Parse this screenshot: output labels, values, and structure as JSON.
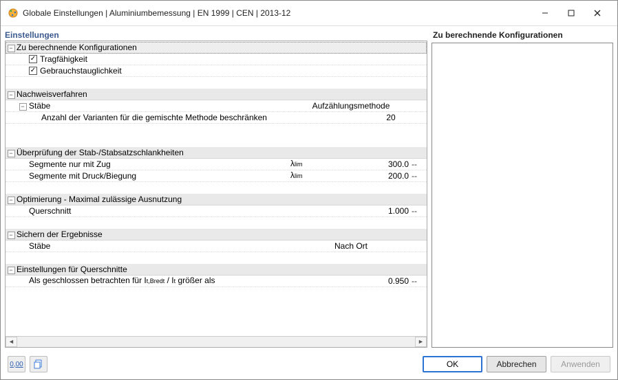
{
  "window": {
    "title": "Globale Einstellungen | Aluminiumbemessung | EN 1999 | CEN | 2013-12"
  },
  "left": {
    "title": "Einstellungen",
    "sections": {
      "configs": {
        "header": "Zu berechnende Konfigurationen",
        "items": {
          "carry": "Tragfähigkeit",
          "service": "Gebrauchstauglichkeit"
        }
      },
      "method": {
        "header": "Nachweisverfahren",
        "bars": {
          "label": "Stäbe",
          "value": "Aufzählungsmethode",
          "limit_label": "Anzahl der Varianten für die gemischte Methode beschränken",
          "limit_value": "20"
        }
      },
      "slender": {
        "header": "Überprüfung der Stab-/Stabsatzschlankheiten",
        "tension": {
          "label": "Segmente nur mit Zug",
          "sym": "λlim",
          "value": "300.0",
          "unit": "--"
        },
        "bending": {
          "label": "Segmente mit Druck/Biegung",
          "sym": "λlim",
          "value": "200.0",
          "unit": "--"
        }
      },
      "opt": {
        "header": "Optimierung - Maximal zulässige Ausnutzung",
        "cs": {
          "label": "Querschnitt",
          "value": "1.000",
          "unit": "--"
        }
      },
      "save": {
        "header": "Sichern der Ergebnisse",
        "bars": {
          "label": "Stäbe",
          "value": "Nach Ort"
        }
      },
      "cs": {
        "header": "Einstellungen für Querschnitte",
        "closed": {
          "label_a": "Als geschlossen betrachten für I",
          "label_b": " / I",
          "label_c": " größer als",
          "sub1": "t,Bredt",
          "sub2": "t",
          "value": "0.950",
          "unit": "--"
        }
      }
    }
  },
  "right": {
    "title": "Zu berechnende Konfigurationen"
  },
  "buttons": {
    "ok": "OK",
    "cancel": "Abbrechen",
    "apply": "Anwenden"
  },
  "toolbar": {
    "unit_hint": "0,00"
  }
}
